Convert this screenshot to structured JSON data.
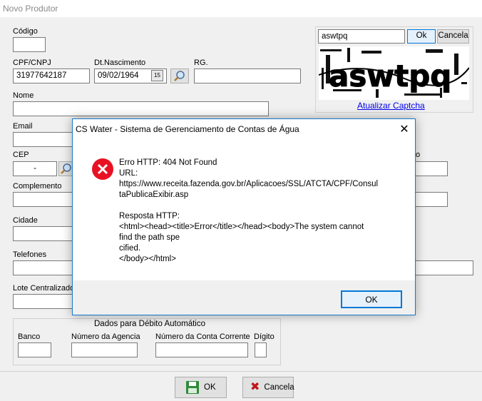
{
  "window": {
    "title": "Novo Produtor"
  },
  "form": {
    "codigo_label": "Código",
    "codigo_value": "",
    "cpf_label": "CPF/CNPJ",
    "cpf_value": "31977642187",
    "dtnasc_label": "Dt.Nascimento",
    "dtnasc_value": "09/02/1964",
    "calendar_glyph": "15",
    "rg_label": "RG.",
    "rg_value": "",
    "nome_label": "Nome",
    "email_label": "Email",
    "cep_label": "CEP",
    "cep_value": "-",
    "complemento_label": "Complemento",
    "cidade_label": "Cidade",
    "telefones_label": "Telefones",
    "lote_label": "Lote Centralizado",
    "partial_right_label": "o"
  },
  "captcha": {
    "input_value": "aswtpq",
    "ok_label": "Ok",
    "cancel_label": "Cancela",
    "image_text": "aswtpq",
    "refresh_link": "Atualizar Captcha"
  },
  "debito": {
    "title": "Dados para Débito Automático",
    "banco_label": "Banco",
    "agencia_label": "Número da Agencia",
    "conta_label": "Número da Conta Corrente",
    "digito_label": "Dígito"
  },
  "bottom": {
    "ok_label": "OK",
    "cancel_label": "Cancela"
  },
  "dialog": {
    "title": "CS Water - Sistema de Gerenciamento de Contas de Água",
    "message": "Erro HTTP: 404 Not Found\nURL:\nhttps://www.receita.fazenda.gov.br/Aplicacoes/SSL/ATCTA/CPF/Consul\ntaPublicaExibir.asp\n\nResposta HTTP:\n<html><head><title>Error</title></head><body>The system cannot\nfind the path spe\ncified.\n</body></html>",
    "ok_label": "OK",
    "close_glyph": "✕"
  },
  "colors": {
    "accent": "#0078d7",
    "error": "#e81123",
    "link": "#0000ee"
  }
}
